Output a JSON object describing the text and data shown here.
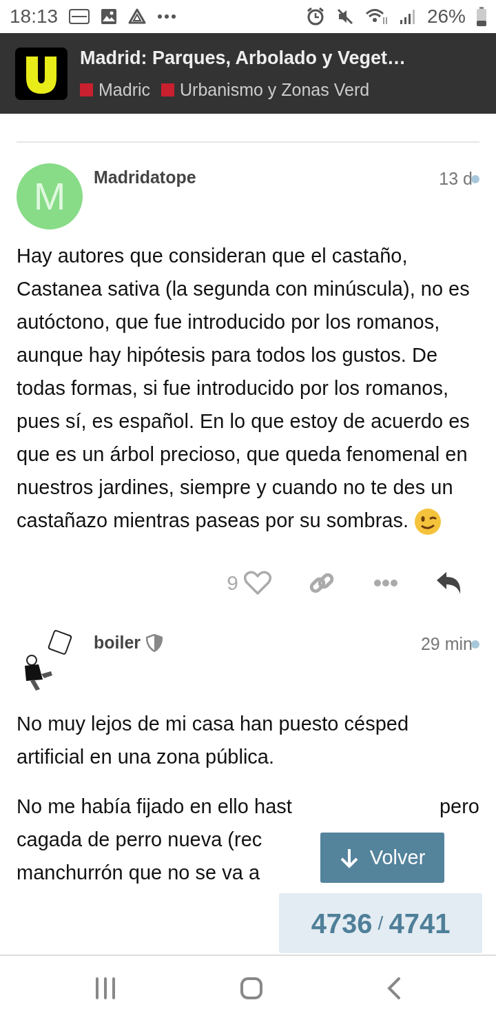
{
  "status_bar": {
    "time": "18:13",
    "battery": "26%"
  },
  "header": {
    "title": "Madrid: Parques, Arbolado y Veget…",
    "categories": [
      {
        "name": "Madric",
        "color": "#c8202e"
      },
      {
        "name": "Urbanismo y Zonas Verd",
        "color": "#c8202e"
      }
    ]
  },
  "posts": [
    {
      "author": "Madridatope",
      "avatar": {
        "kind": "letter",
        "letter": "M"
      },
      "moderator": false,
      "time": "13 d",
      "unread": true,
      "paragraphs": [
        {
          "text": "Hay autores que consideran que el castaño, Castanea sativa (la segunda con minúscula), no es autóctono, que fue introducido por los romanos, aunque hay hipótesis para todos los gustos. De todas formas, si fue introducido por los romanos, pues sí, es español. En lo que estoy de acuerdo es que es un árbol precioso, que queda fenomenal en nuestros jardines, siempre y cuando no te des un castañazo mientras paseas por su sombras.",
          "emoji": true
        }
      ],
      "actions": {
        "likes": "9",
        "liked": false
      }
    },
    {
      "author": "boiler",
      "avatar": {
        "kind": "picture"
      },
      "moderator": true,
      "time": "29 min",
      "unread": true,
      "paragraphs": [
        {
          "text": "No muy lejos de mi casa han puesto césped artificial en una zona pública.",
          "emoji": false
        },
        {
          "lines": [
            [
              "No me había fijado en ello hast",
              "pero"
            ],
            [
              "cagada de perro nueva (rec"
            ],
            [
              "manchurrón que no se va a"
            ]
          ]
        }
      ]
    }
  ],
  "jump_button": {
    "label": "Volver"
  },
  "progress": {
    "current": "4736",
    "separator": "/",
    "total": "4741"
  }
}
